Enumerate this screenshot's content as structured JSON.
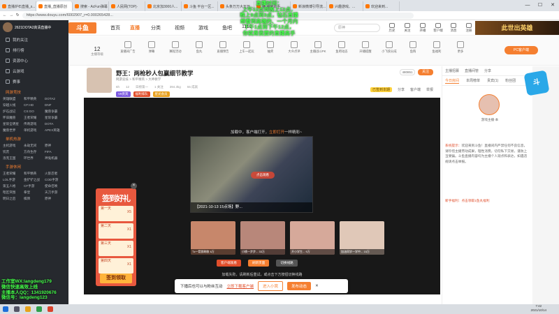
{
  "browser": {
    "tabs": [
      "直播炉石直播_s...",
      "直播_直播原创",
      "搜索 - AcFun弹幕",
      "人民网(TOP)·",
      "北京加3000人...",
      "斗鱼 平台一区...",
      "头条万万大万万...",
      "播 播放助手...",
      "新浪微博引导流...",
      "兴趣游戏、...",
      "欢迎来到..."
    ],
    "url": "https://www.douyu.com/6002907_r=0.000265428...",
    "win_min": "—",
    "win_max": "☐",
    "win_close": "✕"
  },
  "overlay_top": [
    "直播时间：",
    "上午12点到晚上12点，",
    "晚上9点到3点，钻石直播",
    "想看到高端的、一个月内",
    "下午1点到下午12点，",
    "你就是我要的直播高手"
  ],
  "overlay_bottom": [
    "工作室WX:langdeng179",
    "微信快速高效上线",
    "主播本人QQ：1341920676",
    "微信号：langdeng123"
  ],
  "sidebar": {
    "header": "2621DOTA2高清直播中",
    "items": [
      "我的关注",
      "排行榜",
      "资源中心",
      "云游戏",
      "赛事"
    ],
    "sec1": "网游竞技",
    "grid1": [
      "英雄联盟",
      "和平精英",
      "DOTA2",
      "穿越火线",
      "CF:HD",
      "DNF",
      "炉石战记",
      "CS:GO",
      "魔兽争霸",
      "怀旧魔兽",
      "王者荣耀",
      "星际争霸",
      "星际全明星",
      "传奇游戏",
      "DOTA",
      "魔兽世界",
      "单机游戏",
      "APEX英雄"
    ],
    "sec2": "单机热游",
    "grid2": [
      "主机游戏",
      "永劫无间",
      "原神",
      "饥荒",
      "方舟生存",
      "FIFA",
      "洛克王国",
      "环世界",
      "神鬼机器"
    ],
    "sec3": "手游休闲",
    "grid3": [
      "王者荣耀",
      "和平精英",
      "火影忍者",
      "LOL手游",
      "金铲铲之战",
      "COD手游",
      "第五人格",
      "CF手游",
      "使命召唤",
      "暗区突围",
      "拳皇",
      "天刀手游",
      "明日之后",
      "棋牌",
      "原神"
    ]
  },
  "topnav": {
    "logo": "斗鱼",
    "links": [
      "首页",
      "直播",
      "分类",
      "视频",
      "游戏",
      "鱼吧",
      "1110"
    ],
    "search_placeholder": "原神",
    "icons": [
      "历史",
      "关注",
      "开播",
      "客户端",
      "消息",
      "注册"
    ],
    "banner": "此世出英雄"
  },
  "toolbar": {
    "level": "12",
    "level_label": "主播等级",
    "tools": [
      "直播间广告",
      "弹幕",
      "赛程活动",
      "鱼丸",
      "直播预告",
      "上车一起玩",
      "抽奖",
      "大众点评",
      "主播战斗PK",
      "鱼吧动态",
      "开播提醒",
      "小飞侠分成",
      "鱼购",
      "鱼福利",
      "更多"
    ],
    "pc_btn": "PC客户端"
  },
  "room": {
    "title": "野王：两枪秒人包赢细节教学",
    "meta": "网游竞技 > 和平精英 > 大神教学",
    "stats": [
      "6h",
      "12",
      "日榜第一",
      "1 关注",
      "394.3kg",
      "55 成就"
    ],
    "tags": [
      "V8贵宾",
      "福利排队",
      "星光会员"
    ],
    "follow": "关注",
    "fans": "480851",
    "acts": [
      "分享",
      "客户端",
      "举报"
    ],
    "act_badge": "已签到本期"
  },
  "video": {
    "hint_prefix": "加载中，客户端打开，",
    "hint_link": "立即打开",
    "hint_suffix": "一样精彩~",
    "main_caption": "【2021-10-13 15点场】野...",
    "play_btn": "点击观看",
    "recs": [
      {
        "title": "Tz一箭即刷收",
        "views": "6万"
      },
      {
        "title": "小桃一步步...",
        "views": "33万"
      },
      {
        "title": "开小学生...",
        "views": "9万"
      },
      {
        "title": "加油同学一学中...",
        "views": "15万"
      }
    ],
    "fail_text": "加载失败，请刷新后重试，或点击下方按钮切换线路",
    "rec_buttons": [
      "客户端观看",
      "刷新页面",
      "切换线路"
    ]
  },
  "right_panel": {
    "top_tabs": [
      "主播招募",
      "直播间管",
      "分享"
    ],
    "tabs": [
      "今日房间",
      "本周榜单",
      "贵宾(1)",
      "粉丝团"
    ],
    "anchor_name": "游戏主播·本",
    "system_label": "系统提示：",
    "system_msg": "欢迎来到斗鱼！直播间内严禁任何不良信息，请珍惜主播劳动成果，理性消费，切勿私下交易，谨防上当受骗。斗鱼直播内容均为主播个人观点和表达，如遇违规请点击举报。",
    "fan_msg": "新手福利：点击领取1鱼丸福利"
  },
  "signin": {
    "title": "签到好礼",
    "days": [
      {
        "label": "第一天",
        "reward": "X5"
      },
      {
        "label": "第二天",
        "reward": "X1"
      },
      {
        "label": "第三天",
        "reward": "X1"
      },
      {
        "label": "第四天",
        "reward": "X1"
      }
    ],
    "button": "签到领取",
    "close": "×"
  },
  "download_bar": {
    "text": "下播后也可以与粉丝互动",
    "link": "立即下载客户端",
    "btn1": "进入小窝",
    "btn2": "发布动态",
    "close": "✕"
  },
  "taskbar": {
    "time": "7:42",
    "date": "2021/10/14"
  },
  "colors": {
    "accent": "#f57f30",
    "sidebar": "#26292e",
    "overlay": "#45ff4a"
  }
}
